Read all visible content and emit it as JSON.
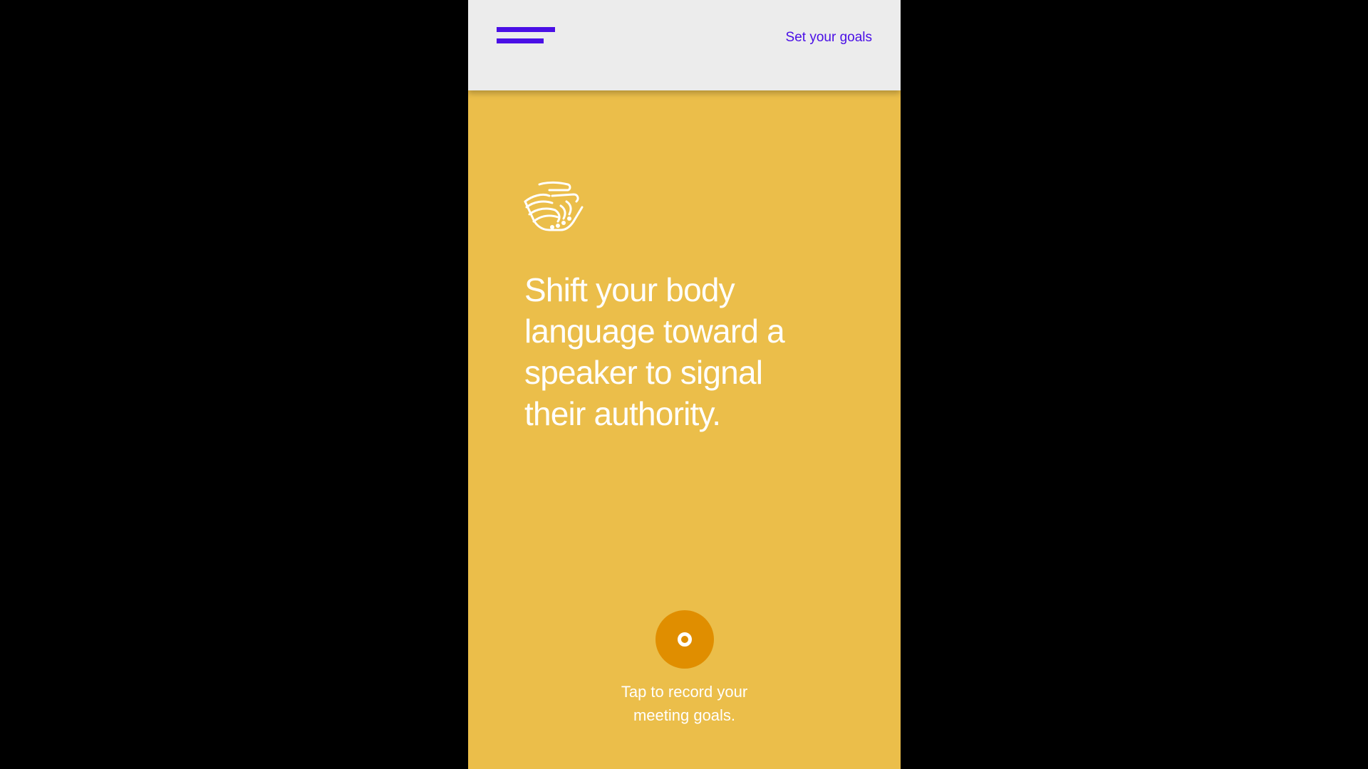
{
  "header": {
    "menu_icon": "hamburger-menu-icon",
    "goals_link_label": "Set your goals"
  },
  "main": {
    "icon": "handshake-icon",
    "tip_text": "Shift your body language toward a speaker to signal their authority.",
    "record_button_icon": "record-icon",
    "record_caption_line1": "Tap to record your",
    "record_caption_line2": "meeting goals."
  },
  "colors": {
    "background": "#000000",
    "header_bg": "#ececec",
    "accent": "#4a0fe6",
    "card_bg": "#ebbe4a",
    "record_button": "#e08e00",
    "text_on_card": "#ffffff"
  }
}
